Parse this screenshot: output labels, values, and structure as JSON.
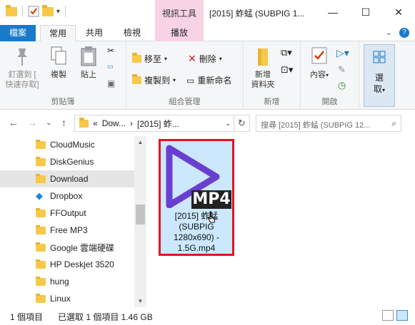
{
  "window": {
    "title": "[2015] 蚱蜢 (SUBPIG 1...",
    "context_tab_title": "視訊工具",
    "minimize": "—",
    "maximize": "☐",
    "close": "✕"
  },
  "tabs": {
    "file": "檔案",
    "home": "常用",
    "share": "共用",
    "view": "檢視",
    "play": "播放"
  },
  "ribbon": {
    "clipboard": {
      "pin_label_1": "釘選到 [",
      "pin_label_2": "快速存取]",
      "copy": "複製",
      "paste": "貼上",
      "group": "剪貼簿"
    },
    "organize": {
      "move_to": "移至",
      "copy_to": "複製到",
      "delete": "刪除",
      "rename": "重新命名",
      "group": "組合管理"
    },
    "new": {
      "new_folder_1": "新增",
      "new_folder_2": "資料夾",
      "group": "新增"
    },
    "open": {
      "properties": "內容",
      "group": "開啟"
    },
    "select": {
      "label_1": "選",
      "label_2": "取"
    }
  },
  "address": {
    "prefix": "«",
    "crumb1": "Dow...",
    "crumb2": "[2015] 蚱...",
    "search_placeholder": "搜尋 [2015] 蚱蜢 (SUBPIG 12..."
  },
  "nav": {
    "items": [
      {
        "label": "CloudMusic"
      },
      {
        "label": "DiskGenius"
      },
      {
        "label": "Download"
      },
      {
        "label": "Dropbox"
      },
      {
        "label": "FFOutput"
      },
      {
        "label": "Free MP3"
      },
      {
        "label": "Google 雲端硬碟"
      },
      {
        "label": "HP Deskjet 3520"
      },
      {
        "label": "hung"
      },
      {
        "label": "Linux"
      }
    ]
  },
  "file": {
    "badge": "MP4",
    "name": "[2015] 蚱蜢 (SUBPIG 1280x690) - 1.5G.mp4"
  },
  "status": {
    "count": "1 個項目",
    "selected": "已選取 1 個項目  1.46 GB"
  },
  "colors": {
    "accent": "#1979ca",
    "selection": "#cce8ff",
    "highlight_border": "#e8101e",
    "play_icon": "#6a3fd0",
    "context_tab": "#f8d3e5"
  }
}
